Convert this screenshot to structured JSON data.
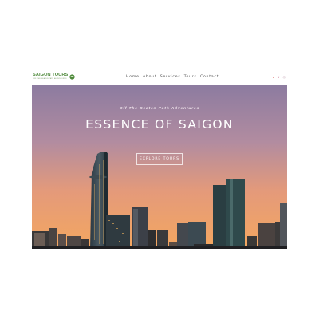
{
  "brand": {
    "name": "SAIGON TOURS",
    "subtitle": "OFF THE BEATEN PATH ADVENTURES",
    "color": "#4f8a3c"
  },
  "nav": {
    "items": [
      "Home",
      "About",
      "Services",
      "Tours",
      "Contact"
    ]
  },
  "social": {
    "icons": [
      {
        "name": "facebook-icon",
        "glyph": "●",
        "color": "#d9534f"
      },
      {
        "name": "twitter-icon",
        "glyph": "♥",
        "color": "#c06a8a"
      },
      {
        "name": "instagram-icon",
        "glyph": "◎",
        "color": "#c0a0b0"
      }
    ]
  },
  "hero": {
    "tagline": "Off The Beaten Path Adventures",
    "title": "ESSENCE OF SAIGON",
    "cta_label": "EXPLORE TOURS",
    "sky_top": "#8a7aa0",
    "sky_bottom": "#f0a06a"
  }
}
